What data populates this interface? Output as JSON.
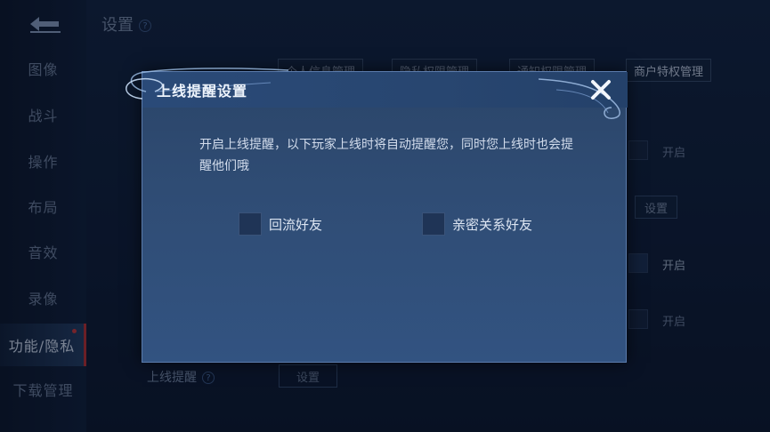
{
  "page": {
    "title": "设置",
    "help": "?"
  },
  "sidebar": {
    "items": [
      {
        "label": "图像"
      },
      {
        "label": "战斗"
      },
      {
        "label": "操作"
      },
      {
        "label": "布局"
      },
      {
        "label": "音效"
      },
      {
        "label": "录像"
      },
      {
        "label": "功能/隐私"
      },
      {
        "label": "下载管理"
      }
    ]
  },
  "tabs": [
    {
      "label": "个人信息管理"
    },
    {
      "label": "隐私权限管理"
    },
    {
      "label": "通知权限管理"
    },
    {
      "label": "商户特权管理"
    }
  ],
  "background_rows": {
    "r1_label": "开启",
    "r2_button": "设置",
    "r3_label": "开启",
    "r4_label": "开启",
    "bottom_label": "上线提醒",
    "bottom_button": "设置"
  },
  "modal": {
    "title": "上线提醒设置",
    "description": "开启上线提醒，以下玩家上线时将自动提醒您，同时您上线时也会提醒他们哦",
    "options": [
      {
        "label": "回流好友",
        "checked": false
      },
      {
        "label": "亲密关系好友",
        "checked": false
      }
    ]
  },
  "colors": {
    "modal_bg": "#2f4c74",
    "accent_red": "#c03030"
  }
}
